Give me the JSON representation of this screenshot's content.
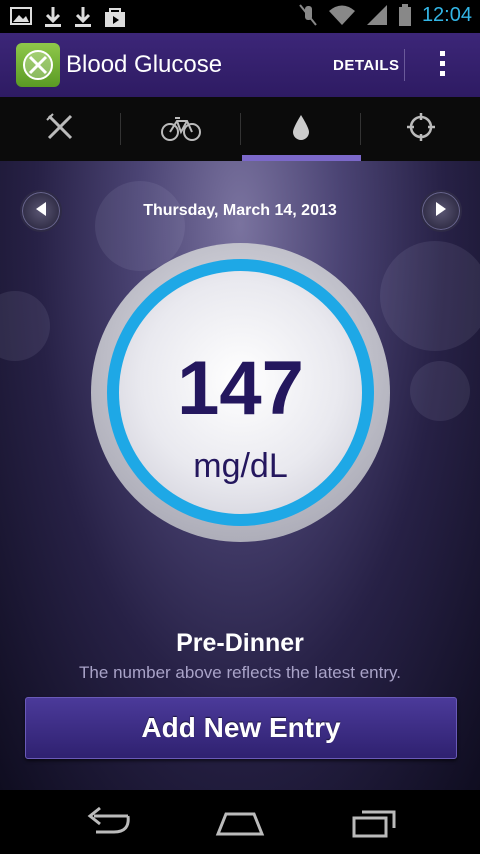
{
  "status_bar": {
    "time": "12:04",
    "left_icons": [
      "image-icon",
      "download-icon",
      "download-icon",
      "shopping-bag-icon"
    ],
    "right_icons": [
      "mute-icon",
      "wifi-icon",
      "signal-icon",
      "battery-icon"
    ]
  },
  "action_bar": {
    "title": "Blood Glucose",
    "details_label": "DETAILS",
    "app_icon": "fork-knife-logo-icon",
    "overflow_icon": "overflow-menu-icon"
  },
  "tabs": [
    {
      "icon": "fork-knife-icon",
      "selected": false
    },
    {
      "icon": "bicycle-icon",
      "selected": false
    },
    {
      "icon": "drop-icon",
      "selected": true
    },
    {
      "icon": "crosshair-icon",
      "selected": false
    }
  ],
  "main": {
    "date": "Thursday, March 14, 2013",
    "reading_value": "147",
    "reading_unit": "mg/dL",
    "meal_label": "Pre-Dinner",
    "note": "The number above reflects the latest entry.",
    "add_button_label": "Add New Entry"
  },
  "colors": {
    "accent_purple": "#3c2678",
    "ring_blue": "#1ea8e6",
    "reading_text": "#24175e",
    "tab_indicator": "#7b68c9"
  },
  "nav_bar": [
    "back-icon",
    "home-icon",
    "recent-apps-icon"
  ]
}
